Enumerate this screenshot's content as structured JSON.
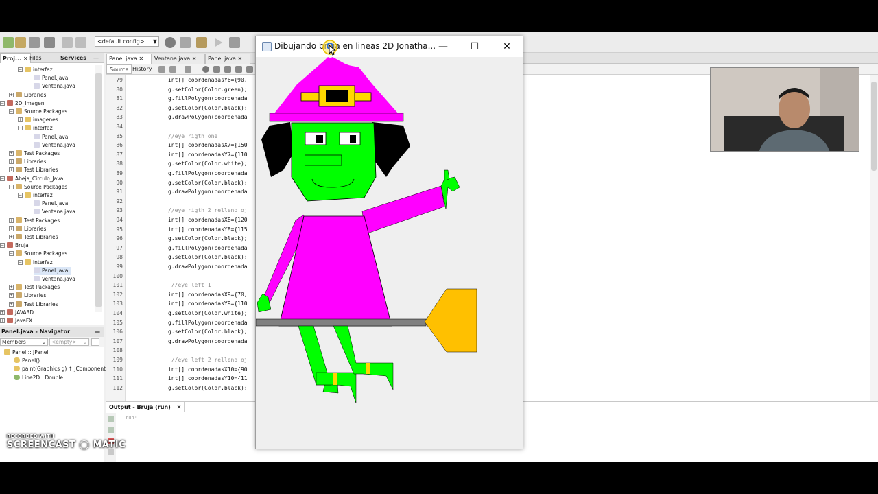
{
  "toolbar": {
    "config_value": "<default config>"
  },
  "projects_panel": {
    "tabs": [
      "Proj...",
      "Files",
      "Services"
    ],
    "tree": [
      {
        "label": "interfaz",
        "depth": 2,
        "kind": "package"
      },
      {
        "label": "Panel.java",
        "depth": 3,
        "kind": "file"
      },
      {
        "label": "Ventana.java",
        "depth": 3,
        "kind": "file"
      },
      {
        "label": "Libraries",
        "depth": 1,
        "kind": "lib"
      },
      {
        "label": "2D_Imagen",
        "depth": 0,
        "kind": "project"
      },
      {
        "label": "Source Packages",
        "depth": 1,
        "kind": "src"
      },
      {
        "label": "imagenes",
        "depth": 2,
        "kind": "package"
      },
      {
        "label": "interfaz",
        "depth": 2,
        "kind": "package"
      },
      {
        "label": "Panel.java",
        "depth": 3,
        "kind": "file"
      },
      {
        "label": "Ventana.java",
        "depth": 3,
        "kind": "file"
      },
      {
        "label": "Test Packages",
        "depth": 1,
        "kind": "src"
      },
      {
        "label": "Libraries",
        "depth": 1,
        "kind": "lib"
      },
      {
        "label": "Test Libraries",
        "depth": 1,
        "kind": "lib"
      },
      {
        "label": "Abeja_Circulo_Java",
        "depth": 0,
        "kind": "project"
      },
      {
        "label": "Source Packages",
        "depth": 1,
        "kind": "src"
      },
      {
        "label": "interfaz",
        "depth": 2,
        "kind": "package"
      },
      {
        "label": "Panel.java",
        "depth": 3,
        "kind": "file"
      },
      {
        "label": "Ventana.java",
        "depth": 3,
        "kind": "file"
      },
      {
        "label": "Test Packages",
        "depth": 1,
        "kind": "src"
      },
      {
        "label": "Libraries",
        "depth": 1,
        "kind": "lib"
      },
      {
        "label": "Test Libraries",
        "depth": 1,
        "kind": "lib"
      },
      {
        "label": "Bruja",
        "depth": 0,
        "kind": "project"
      },
      {
        "label": "Source Packages",
        "depth": 1,
        "kind": "src"
      },
      {
        "label": "interfaz",
        "depth": 2,
        "kind": "package"
      },
      {
        "label": "Panel.java",
        "depth": 3,
        "kind": "file",
        "selected": true
      },
      {
        "label": "Ventana.java",
        "depth": 3,
        "kind": "file"
      },
      {
        "label": "Test Packages",
        "depth": 1,
        "kind": "src"
      },
      {
        "label": "Libraries",
        "depth": 1,
        "kind": "lib"
      },
      {
        "label": "Test Libraries",
        "depth": 1,
        "kind": "lib"
      },
      {
        "label": "JAVA3D",
        "depth": 0,
        "kind": "project"
      },
      {
        "label": "JavaFX",
        "depth": 0,
        "kind": "project"
      }
    ]
  },
  "navigator": {
    "title": "Panel.java - Navigator",
    "filter_members": "Members",
    "filter_empty": "<empty>",
    "items": [
      {
        "label": "Panel :: JPanel",
        "depth": 0
      },
      {
        "label": "Panel()",
        "depth": 1
      },
      {
        "label": "paint(Graphics g) ↑ JComponent",
        "depth": 1
      },
      {
        "label": "Line2D : Double",
        "depth": 1
      }
    ]
  },
  "editor": {
    "tabs": [
      "Panel.java",
      "Ventana.java",
      "Panel.java"
    ],
    "source_label": "Source",
    "history_label": "History",
    "lines": [
      {
        "no": "79",
        "text": "int[] coordenadasY6={90,",
        "type": "code"
      },
      {
        "no": "80",
        "text": "g.setColor(Color.green);",
        "type": "code"
      },
      {
        "no": "81",
        "text": "g.fillPolygon(coordenada",
        "type": "code"
      },
      {
        "no": "82",
        "text": "g.setColor(Color.black);",
        "type": "code"
      },
      {
        "no": "83",
        "text": "g.drawPolygon(coordenada",
        "type": "code"
      },
      {
        "no": "84",
        "text": "",
        "type": "code"
      },
      {
        "no": "85",
        "text": "//eye rigth one",
        "type": "comment"
      },
      {
        "no": "86",
        "text": "int[] coordenadasX7={150",
        "type": "code"
      },
      {
        "no": "87",
        "text": "int[] coordenadasY7={110",
        "type": "code"
      },
      {
        "no": "88",
        "text": "g.setColor(Color.white);",
        "type": "code"
      },
      {
        "no": "89",
        "text": "g.fillPolygon(coordenada",
        "type": "code"
      },
      {
        "no": "90",
        "text": "g.setColor(Color.black);",
        "type": "code"
      },
      {
        "no": "91",
        "text": "g.drawPolygon(coordenada",
        "type": "code"
      },
      {
        "no": "92",
        "text": "",
        "type": "code"
      },
      {
        "no": "93",
        "text": "//eye rigth 2 relleno oj",
        "type": "comment"
      },
      {
        "no": "94",
        "text": "int[] coordenadasX8={120",
        "type": "code"
      },
      {
        "no": "95",
        "text": "int[] coordenadasY8={115",
        "type": "code"
      },
      {
        "no": "96",
        "text": "g.setColor(Color.black);",
        "type": "code"
      },
      {
        "no": "97",
        "text": "g.fillPolygon(coordenada",
        "type": "code"
      },
      {
        "no": "98",
        "text": "g.setColor(Color.black);",
        "type": "code"
      },
      {
        "no": "99",
        "text": "g.drawPolygon(coordenada",
        "type": "code"
      },
      {
        "no": "100",
        "text": "",
        "type": "code"
      },
      {
        "no": "101",
        "text": " //eye left 1",
        "type": "comment"
      },
      {
        "no": "102",
        "text": "int[] coordenadasX9={70,",
        "type": "code"
      },
      {
        "no": "103",
        "text": "int[] coordenadasY9={110",
        "type": "code"
      },
      {
        "no": "104",
        "text": "g.setColor(Color.white);",
        "type": "code"
      },
      {
        "no": "105",
        "text": "g.fillPolygon(coordenada",
        "type": "code"
      },
      {
        "no": "106",
        "text": "g.setColor(Color.black);",
        "type": "code"
      },
      {
        "no": "107",
        "text": "g.drawPolygon(coordenada",
        "type": "code"
      },
      {
        "no": "108",
        "text": "",
        "type": "code"
      },
      {
        "no": "109",
        "text": " //eye left 2 relleno oj",
        "type": "comment"
      },
      {
        "no": "110",
        "text": "int[] coordenadasX10={90",
        "type": "code"
      },
      {
        "no": "111",
        "text": "int[] coordenadasY10={11",
        "type": "code"
      },
      {
        "no": "112",
        "text": "g.setColor(Color.black);",
        "type": "code"
      }
    ]
  },
  "output": {
    "tab_label": "Output - Bruja (run)",
    "text": "run:"
  },
  "app_window": {
    "title": "Dibujando bruja en lineas 2D Jonatha...",
    "minimize": "—",
    "maximize": "☐",
    "close": "✕"
  },
  "watermark": {
    "line1": "RECORDED WITH",
    "line2": "SCREENCAST ◯ MATIC"
  },
  "colors": {
    "magenta": "#ff00ff",
    "green": "#00ff00",
    "yellow": "#ffd700",
    "broom": "#ffc000",
    "stick": "#808080",
    "black": "#000000"
  }
}
